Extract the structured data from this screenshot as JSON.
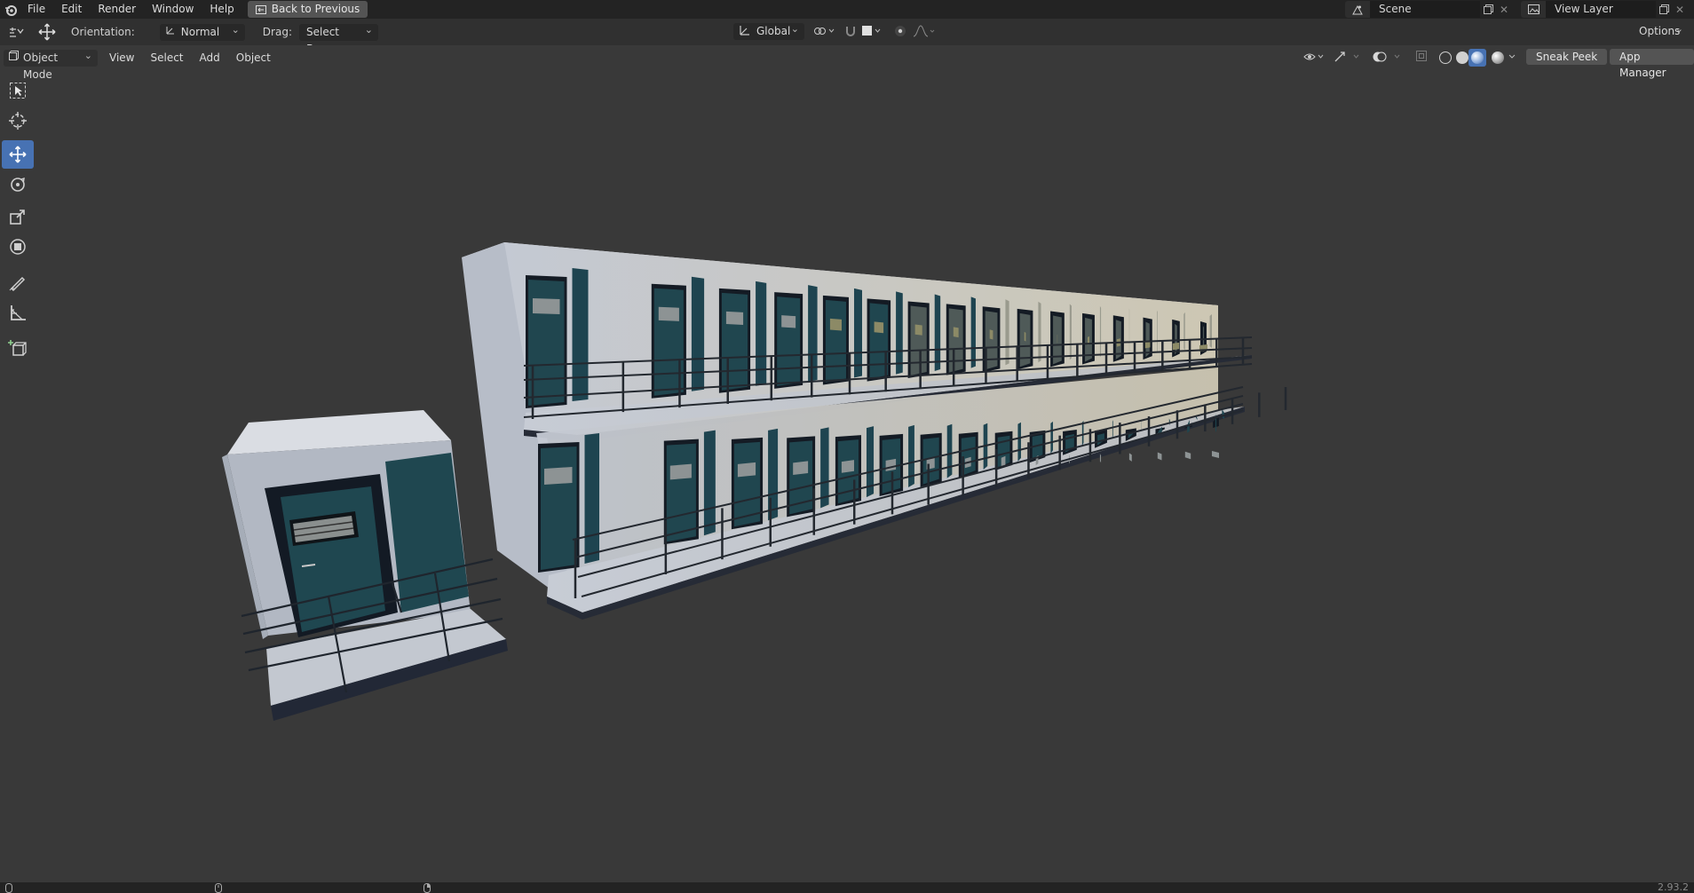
{
  "menu": {
    "file": "File",
    "edit": "Edit",
    "render": "Render",
    "window": "Window",
    "help": "Help",
    "back_button": "Back to Previous"
  },
  "scene": {
    "name": "Scene",
    "view_layer": "View Layer"
  },
  "tool_header": {
    "orientation_label": "Orientation:",
    "orientation_value": "Normal",
    "drag_label": "Drag:",
    "drag_value": "Select Box",
    "transform_orientation": "Global",
    "options": "Options"
  },
  "view_header": {
    "mode": "Object Mode",
    "view": "View",
    "select": "Select",
    "add": "Add",
    "object": "Object",
    "sneak_peek": "Sneak Peek",
    "app_manager": "App Manager"
  },
  "status": {
    "version": "2.93.2"
  },
  "colors": {
    "accent": "#4772b3",
    "top_bar": "#232323",
    "header": "#303030",
    "viewport": "#393939",
    "wall": "#aab2bf",
    "door": "#1c3d44"
  },
  "icons": {
    "logo": "blender-logo-icon",
    "select_box_tool": "select-box-icon",
    "cursor_tool": "cursor-icon",
    "move_tool": "move-icon",
    "rotate_tool": "rotate-icon",
    "scale_tool": "scale-icon",
    "transform_tool": "transform-icon",
    "annotate_tool": "annotate-icon",
    "measure_tool": "measure-icon",
    "add_cube_tool": "add-cube-icon"
  }
}
